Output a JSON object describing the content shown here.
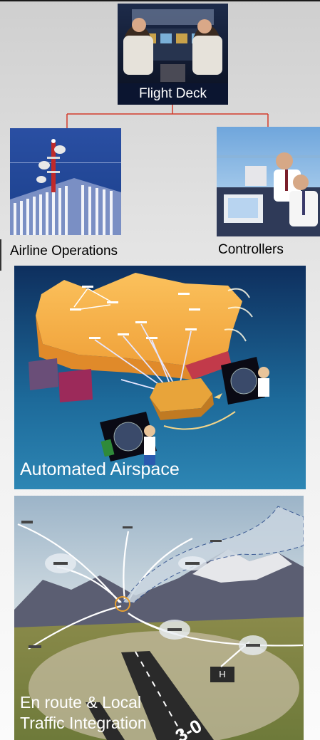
{
  "top": {
    "caption": "Flight Deck"
  },
  "left": {
    "caption": "Airline Operations"
  },
  "right": {
    "caption": "Controllers"
  },
  "middle": {
    "caption": "Automated Airspace"
  },
  "bottom": {
    "caption_line1": "En route & Local",
    "caption_line2": "Traffic Integration",
    "runway_number": "3-0",
    "helipad_letter": "H"
  },
  "colors": {
    "connector": "#d33a2a",
    "sky_blue": "#1a3f8a",
    "caption_dark": "#0b1530"
  }
}
